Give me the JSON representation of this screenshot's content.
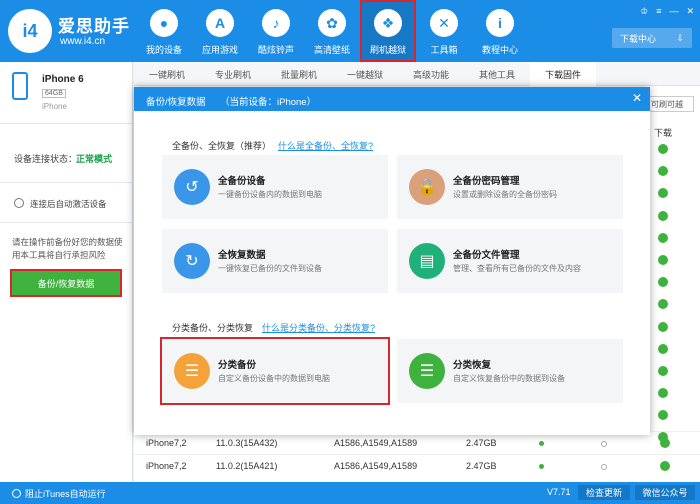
{
  "app": {
    "brand_name": "爱思助手",
    "brand_url": "www.i4.cn",
    "logo_text": "i4"
  },
  "nav": [
    {
      "label": "我的设备",
      "icon": "apple-icon",
      "glyph": "●"
    },
    {
      "label": "应用游戏",
      "icon": "app-store-icon",
      "glyph": "A"
    },
    {
      "label": "酷炫铃声",
      "icon": "bell-icon",
      "glyph": "♪"
    },
    {
      "label": "高清壁纸",
      "icon": "flower-icon",
      "glyph": "✿"
    },
    {
      "label": "刷机越狱",
      "icon": "dropbox-icon",
      "glyph": "❖"
    },
    {
      "label": "工具箱",
      "icon": "tools-icon",
      "glyph": "✕"
    },
    {
      "label": "教程中心",
      "icon": "info-icon",
      "glyph": "i"
    }
  ],
  "window_controls": [
    "♔",
    "≡",
    "—",
    "✕"
  ],
  "download_center": {
    "label": "下载中心",
    "icon": "download-icon",
    "glyph": "⇩"
  },
  "device": {
    "name": "iPhone 6",
    "capacity": "64GB",
    "model": "iPhone",
    "conn_label": "设备连接状态：",
    "conn_value": "正常模式",
    "auto_activate": "连接后自动激活设备",
    "warning": "请在操作前备份好您的数据使用本工具将自行承担风险",
    "backup_button": "备份/恢复数据"
  },
  "tabs": [
    "一键刷机",
    "专业刷机",
    "批量刷机",
    "一键越狱",
    "高级功能",
    "其他工具",
    "下载固件"
  ],
  "main": {
    "right_button": "可刷可越",
    "download_header": "下载"
  },
  "table_rows": [
    {
      "model": "iPhone7,2",
      "version": "11.0.3(15A432)",
      "types": "A1586,A1549,A1589",
      "size": "2.47GB"
    },
    {
      "model": "iPhone7,2",
      "version": "11.0.2(15A421)",
      "types": "A1586,A1549,A1589",
      "size": "2.47GB"
    }
  ],
  "modal": {
    "title": "备份/恢复数据",
    "device": "（当前设备：iPhone）",
    "close": "✕",
    "section1_title": "全备份、全恢复（推荐）",
    "section1_link": "什么是全备份、全恢复?",
    "section2_title": "分类备份、分类恢复",
    "section2_link": "什么是分类备份、分类恢复?",
    "cards": [
      {
        "title": "全备份设备",
        "desc": "一键备份设备内的数据到电脑",
        "icon": "backup-icon",
        "glyph": "↺",
        "color": "#3a96e8"
      },
      {
        "title": "全备份密码管理",
        "desc": "设置或删除设备的全备份密码",
        "icon": "lock-icon",
        "glyph": "🔒",
        "color": "#d9a07a"
      },
      {
        "title": "全恢复数据",
        "desc": "一键恢复已备份的文件到设备",
        "icon": "restore-icon",
        "glyph": "↻",
        "color": "#3a96e8"
      },
      {
        "title": "全备份文件管理",
        "desc": "管理、查看所有已备份的文件及内容",
        "icon": "folder-icon",
        "glyph": "▤",
        "color": "#20b07a"
      },
      {
        "title": "分类备份",
        "desc": "自定义备份设备中的数据到电脑",
        "icon": "category-backup-icon",
        "glyph": "☰",
        "color": "#f3a33a"
      },
      {
        "title": "分类恢复",
        "desc": "自定义恢复备份中的数据到设备",
        "icon": "category-restore-icon",
        "glyph": "☰",
        "color": "#3fb13d"
      }
    ]
  },
  "status": {
    "stop_itunes": "阻止iTunes自动运行",
    "version": "V7.71",
    "check_update": "检查更新",
    "wechat": "微信公众号"
  }
}
